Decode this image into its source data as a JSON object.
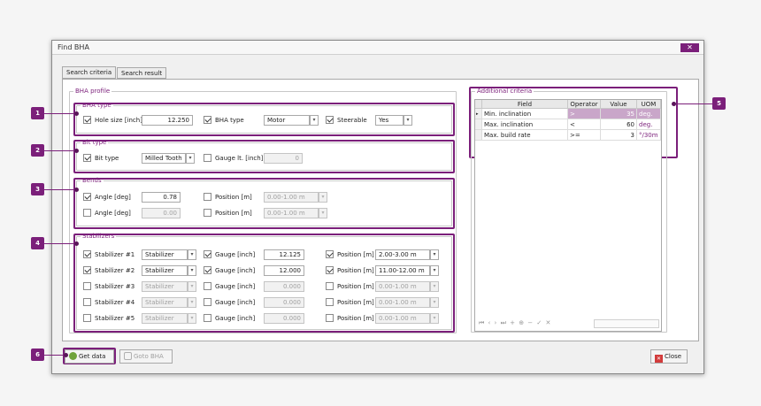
{
  "window": {
    "title": "Find BHA",
    "close_glyph": "✕"
  },
  "tabs": [
    {
      "label": "Search criteria",
      "active": true
    },
    {
      "label": "Search result",
      "active": false
    }
  ],
  "bha_profile": {
    "legend": "BHA profile"
  },
  "bha_type": {
    "legend": "BHA type",
    "hole_size_label": "Hole size [inch]",
    "hole_size_checked": true,
    "hole_size_value": "12.250",
    "bha_type_label": "BHA type",
    "bha_type_checked": true,
    "bha_type_value": "Motor",
    "steerable_label": "Steerable",
    "steerable_checked": true,
    "steerable_value": "Yes"
  },
  "bit_type": {
    "legend": "Bit type",
    "bit_type_label": "Bit type",
    "bit_type_checked": true,
    "bit_type_value": "Milled Tooth",
    "gauge_label": "Gauge lt. [inch]",
    "gauge_checked": false,
    "gauge_value": "0"
  },
  "bends": {
    "legend": "Bends",
    "rows": [
      {
        "angle_label": "Angle [deg]",
        "angle_checked": true,
        "angle_value": "0.78",
        "position_label": "Position [m]",
        "position_checked": false,
        "position_value": "0.00-1.00 m"
      },
      {
        "angle_label": "Angle [deg]",
        "angle_checked": false,
        "angle_value": "0.00",
        "position_label": "Position [m]",
        "position_checked": false,
        "position_value": "0.00-1.00 m"
      }
    ]
  },
  "stabilizers": {
    "legend": "Stabilizers",
    "rows": [
      {
        "label": "Stabilizer #1",
        "checked": true,
        "type": "Stabilizer",
        "gauge_label": "Gauge [inch]",
        "gauge_checked": true,
        "gauge_value": "12.125",
        "position_label": "Position [m]",
        "position_checked": true,
        "position_value": "2.00-3.00 m"
      },
      {
        "label": "Stabilizer #2",
        "checked": true,
        "type": "Stabilizer",
        "gauge_label": "Gauge [inch]",
        "gauge_checked": true,
        "gauge_value": "12.000",
        "position_label": "Position [m]",
        "position_checked": true,
        "position_value": "11.00-12.00 m"
      },
      {
        "label": "Stabilizer #3",
        "checked": false,
        "type": "Stabilizer",
        "gauge_label": "Gauge [inch]",
        "gauge_checked": false,
        "gauge_value": "0.000",
        "position_label": "Position [m]",
        "position_checked": false,
        "position_value": "0.00-1.00 m"
      },
      {
        "label": "Stabilizer #4",
        "checked": false,
        "type": "Stabilizer",
        "gauge_label": "Gauge [inch]",
        "gauge_checked": false,
        "gauge_value": "0.000",
        "position_label": "Position [m]",
        "position_checked": false,
        "position_value": "0.00-1.00 m"
      },
      {
        "label": "Stabilizer #5",
        "checked": false,
        "type": "Stabilizer",
        "gauge_label": "Gauge [inch]",
        "gauge_checked": false,
        "gauge_value": "0.000",
        "position_label": "Position [m]",
        "position_checked": false,
        "position_value": "0.00-1.00 m"
      }
    ]
  },
  "additional_criteria": {
    "legend": "Additional criteria",
    "columns": [
      "Field",
      "Operator",
      "Value",
      "UOM"
    ],
    "rows": [
      {
        "field": "Min. inclination",
        "operator": ">",
        "value": "35",
        "uom": "deg."
      },
      {
        "field": "Max. inclination",
        "operator": "<",
        "value": "60",
        "uom": "deg."
      },
      {
        "field": "Max. build rate",
        "operator": ">=",
        "value": "3",
        "uom": "°/30m"
      }
    ],
    "navigator": "⏮ ‹ › ⏭ + ⊕ − ✓ ✕"
  },
  "buttons": {
    "get_data": "Get data",
    "goto_bha": "Goto BHA",
    "close": "Close"
  },
  "callouts": [
    "1",
    "2",
    "3",
    "4",
    "5",
    "6"
  ],
  "colors": {
    "accent": "#7b1f7a",
    "selected_row": "#c9a6c9"
  }
}
